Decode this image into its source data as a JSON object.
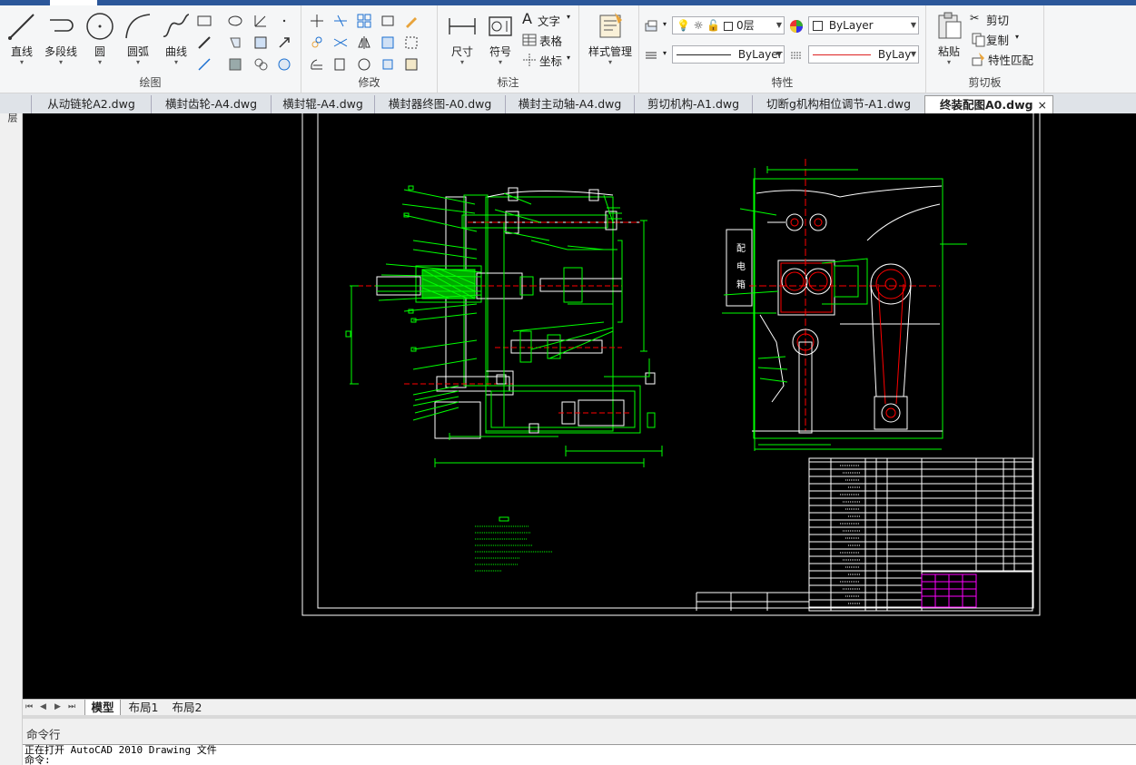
{
  "ribbon": {
    "draw": {
      "label": "绘图",
      "line": "直线",
      "polyline": "多段线",
      "circle": "圆",
      "arc": "圆弧",
      "curve": "曲线"
    },
    "modify": {
      "label": "修改"
    },
    "annotation": {
      "label": "标注",
      "dimension": "尺寸",
      "symbol": "符号",
      "text": "文字",
      "table": "表格",
      "coordinate": "坐标"
    },
    "style": {
      "label": "样式管理"
    },
    "properties": {
      "label": "特性",
      "layer_value": "0层",
      "color_value": "ByLayer",
      "linetype_value": "ByLayer",
      "lineweight_value": "ByLay"
    },
    "clipboard": {
      "label": "剪切板",
      "paste": "粘贴",
      "cut": "剪切",
      "copy": "复制",
      "match": "特性匹配"
    }
  },
  "document_tabs": [
    {
      "label": "从动链轮A2.dwg"
    },
    {
      "label": "横封齿轮-A4.dwg"
    },
    {
      "label": "横封辊-A4.dwg"
    },
    {
      "label": "横封器终图-A0.dwg"
    },
    {
      "label": "横封主动轴-A4.dwg"
    },
    {
      "label": "剪切机构-A1.dwg"
    },
    {
      "label": "切断g机构相位调节-A1.dwg"
    },
    {
      "label": "终装配图A0.dwg",
      "active": true
    }
  ],
  "tab_close": "×",
  "left_panel_label": "图层",
  "layout_tabs": [
    {
      "label": "模型",
      "active": true
    },
    {
      "label": "布局1"
    },
    {
      "label": "布局2"
    }
  ],
  "nav_buttons": [
    "⏮",
    "◀",
    "▶",
    "⏭"
  ],
  "command": {
    "header": "命令行",
    "history": [
      "正在打开 AutoCAD 2010 Drawing 文件",
      "命令:"
    ]
  },
  "drawing": {
    "side_label": [
      "配",
      "电",
      "箱"
    ]
  },
  "colors": {
    "accent": "#2b579a",
    "canvas": "#000000",
    "cad_green": "#00ff00",
    "cad_red": "#ff0000",
    "cad_white": "#ffffff",
    "cad_magenta": "#ff00ff"
  }
}
